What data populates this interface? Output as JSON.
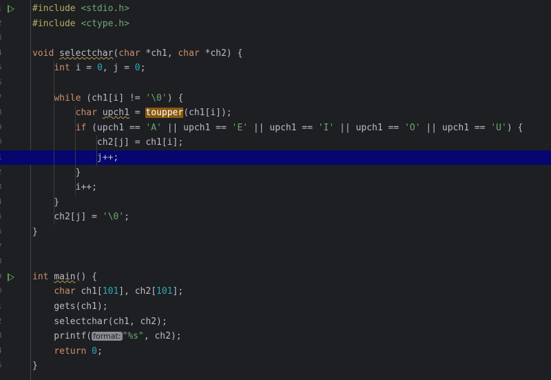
{
  "editor": {
    "gutter": [
      "1",
      "2",
      "3",
      "4",
      "5",
      "6",
      "7",
      "8",
      "9",
      "0",
      "1",
      "2",
      "3",
      "4",
      "5",
      "6",
      "7",
      "8",
      "9",
      "0",
      "1",
      "2",
      "3",
      "4",
      "5"
    ],
    "current_line_index": 10,
    "run_marker_lines": [
      0,
      18
    ],
    "lines": [
      [
        {
          "t": "#include ",
          "c": "pp"
        },
        {
          "t": "<stdio.h>",
          "c": "inc"
        }
      ],
      [
        {
          "t": "#include ",
          "c": "pp"
        },
        {
          "t": "<ctype.h>",
          "c": "inc"
        }
      ],
      [],
      [
        {
          "t": "void ",
          "c": "kw"
        },
        {
          "t": "selectchar",
          "c": "def"
        },
        {
          "t": "(",
          "c": "p"
        },
        {
          "t": "char ",
          "c": "kw"
        },
        {
          "t": "*ch1, ",
          "c": "p"
        },
        {
          "t": "char ",
          "c": "kw"
        },
        {
          "t": "*ch2) {",
          "c": "p"
        }
      ],
      [
        {
          "t": "    ",
          "c": "p"
        },
        {
          "t": "int ",
          "c": "kw"
        },
        {
          "t": "i = ",
          "c": "p"
        },
        {
          "t": "0",
          "c": "num"
        },
        {
          "t": ", j = ",
          "c": "p"
        },
        {
          "t": "0",
          "c": "num"
        },
        {
          "t": ";",
          "c": "p"
        }
      ],
      [],
      [
        {
          "t": "    ",
          "c": "p"
        },
        {
          "t": "while ",
          "c": "kw"
        },
        {
          "t": "(ch1[i] != ",
          "c": "p"
        },
        {
          "t": "'\\0'",
          "c": "str"
        },
        {
          "t": ") {",
          "c": "p"
        }
      ],
      [
        {
          "t": "        ",
          "c": "p"
        },
        {
          "t": "char ",
          "c": "kw"
        },
        {
          "t": "upch1",
          "c": "sq"
        },
        {
          "t": " = ",
          "c": "p"
        },
        {
          "t": "toupper",
          "c": "hl"
        },
        {
          "t": "(ch1[i]);",
          "c": "p"
        }
      ],
      [
        {
          "t": "        ",
          "c": "p"
        },
        {
          "t": "if ",
          "c": "kw"
        },
        {
          "t": "(upch1 == ",
          "c": "p"
        },
        {
          "t": "'A'",
          "c": "str"
        },
        {
          "t": " || upch1 == ",
          "c": "p"
        },
        {
          "t": "'E'",
          "c": "str"
        },
        {
          "t": " || upch1 == ",
          "c": "p"
        },
        {
          "t": "'I'",
          "c": "str"
        },
        {
          "t": " || upch1 == ",
          "c": "p"
        },
        {
          "t": "'O'",
          "c": "str"
        },
        {
          "t": " || upch1 == ",
          "c": "p"
        },
        {
          "t": "'U'",
          "c": "str"
        },
        {
          "t": ") {",
          "c": "p"
        }
      ],
      [
        {
          "t": "            ch2[j] = ch1[i];",
          "c": "p"
        }
      ],
      [
        {
          "t": "            j++;",
          "c": "p"
        }
      ],
      [
        {
          "t": "        }",
          "c": "p"
        }
      ],
      [
        {
          "t": "        i++;",
          "c": "p"
        }
      ],
      [
        {
          "t": "    }",
          "c": "p"
        }
      ],
      [
        {
          "t": "    ch2[j] = ",
          "c": "p"
        },
        {
          "t": "'\\0'",
          "c": "str"
        },
        {
          "t": ";",
          "c": "p"
        }
      ],
      [
        {
          "t": "}",
          "c": "p"
        }
      ],
      [],
      [],
      [
        {
          "t": "int ",
          "c": "kw"
        },
        {
          "t": "main",
          "c": "def"
        },
        {
          "t": "() {",
          "c": "p"
        }
      ],
      [
        {
          "t": "    ",
          "c": "p"
        },
        {
          "t": "char ",
          "c": "kw"
        },
        {
          "t": "ch1[",
          "c": "p"
        },
        {
          "t": "101",
          "c": "num"
        },
        {
          "t": "], ch2[",
          "c": "p"
        },
        {
          "t": "101",
          "c": "num"
        },
        {
          "t": "];",
          "c": "p"
        }
      ],
      [
        {
          "t": "    gets(ch1);",
          "c": "p"
        }
      ],
      [
        {
          "t": "    selectchar(ch1, ch2);",
          "c": "p"
        }
      ],
      [
        {
          "t": "    printf(",
          "c": "p"
        },
        {
          "t": "format:",
          "c": "hint"
        },
        {
          "t": "\"%s\"",
          "c": "str"
        },
        {
          "t": ", ch2);",
          "c": "p"
        }
      ],
      [
        {
          "t": "    ",
          "c": "p"
        },
        {
          "t": "return ",
          "c": "kw"
        },
        {
          "t": "0",
          "c": "num"
        },
        {
          "t": ";",
          "c": "p"
        }
      ],
      [
        {
          "t": "}",
          "c": "p"
        }
      ]
    ]
  },
  "colors": {
    "background": "#1e1f22",
    "current_line": "#06066e",
    "keyword": "#cf8e6d",
    "string": "#6aab73",
    "number": "#2aacb8",
    "run_marker": "#5a9e55"
  }
}
